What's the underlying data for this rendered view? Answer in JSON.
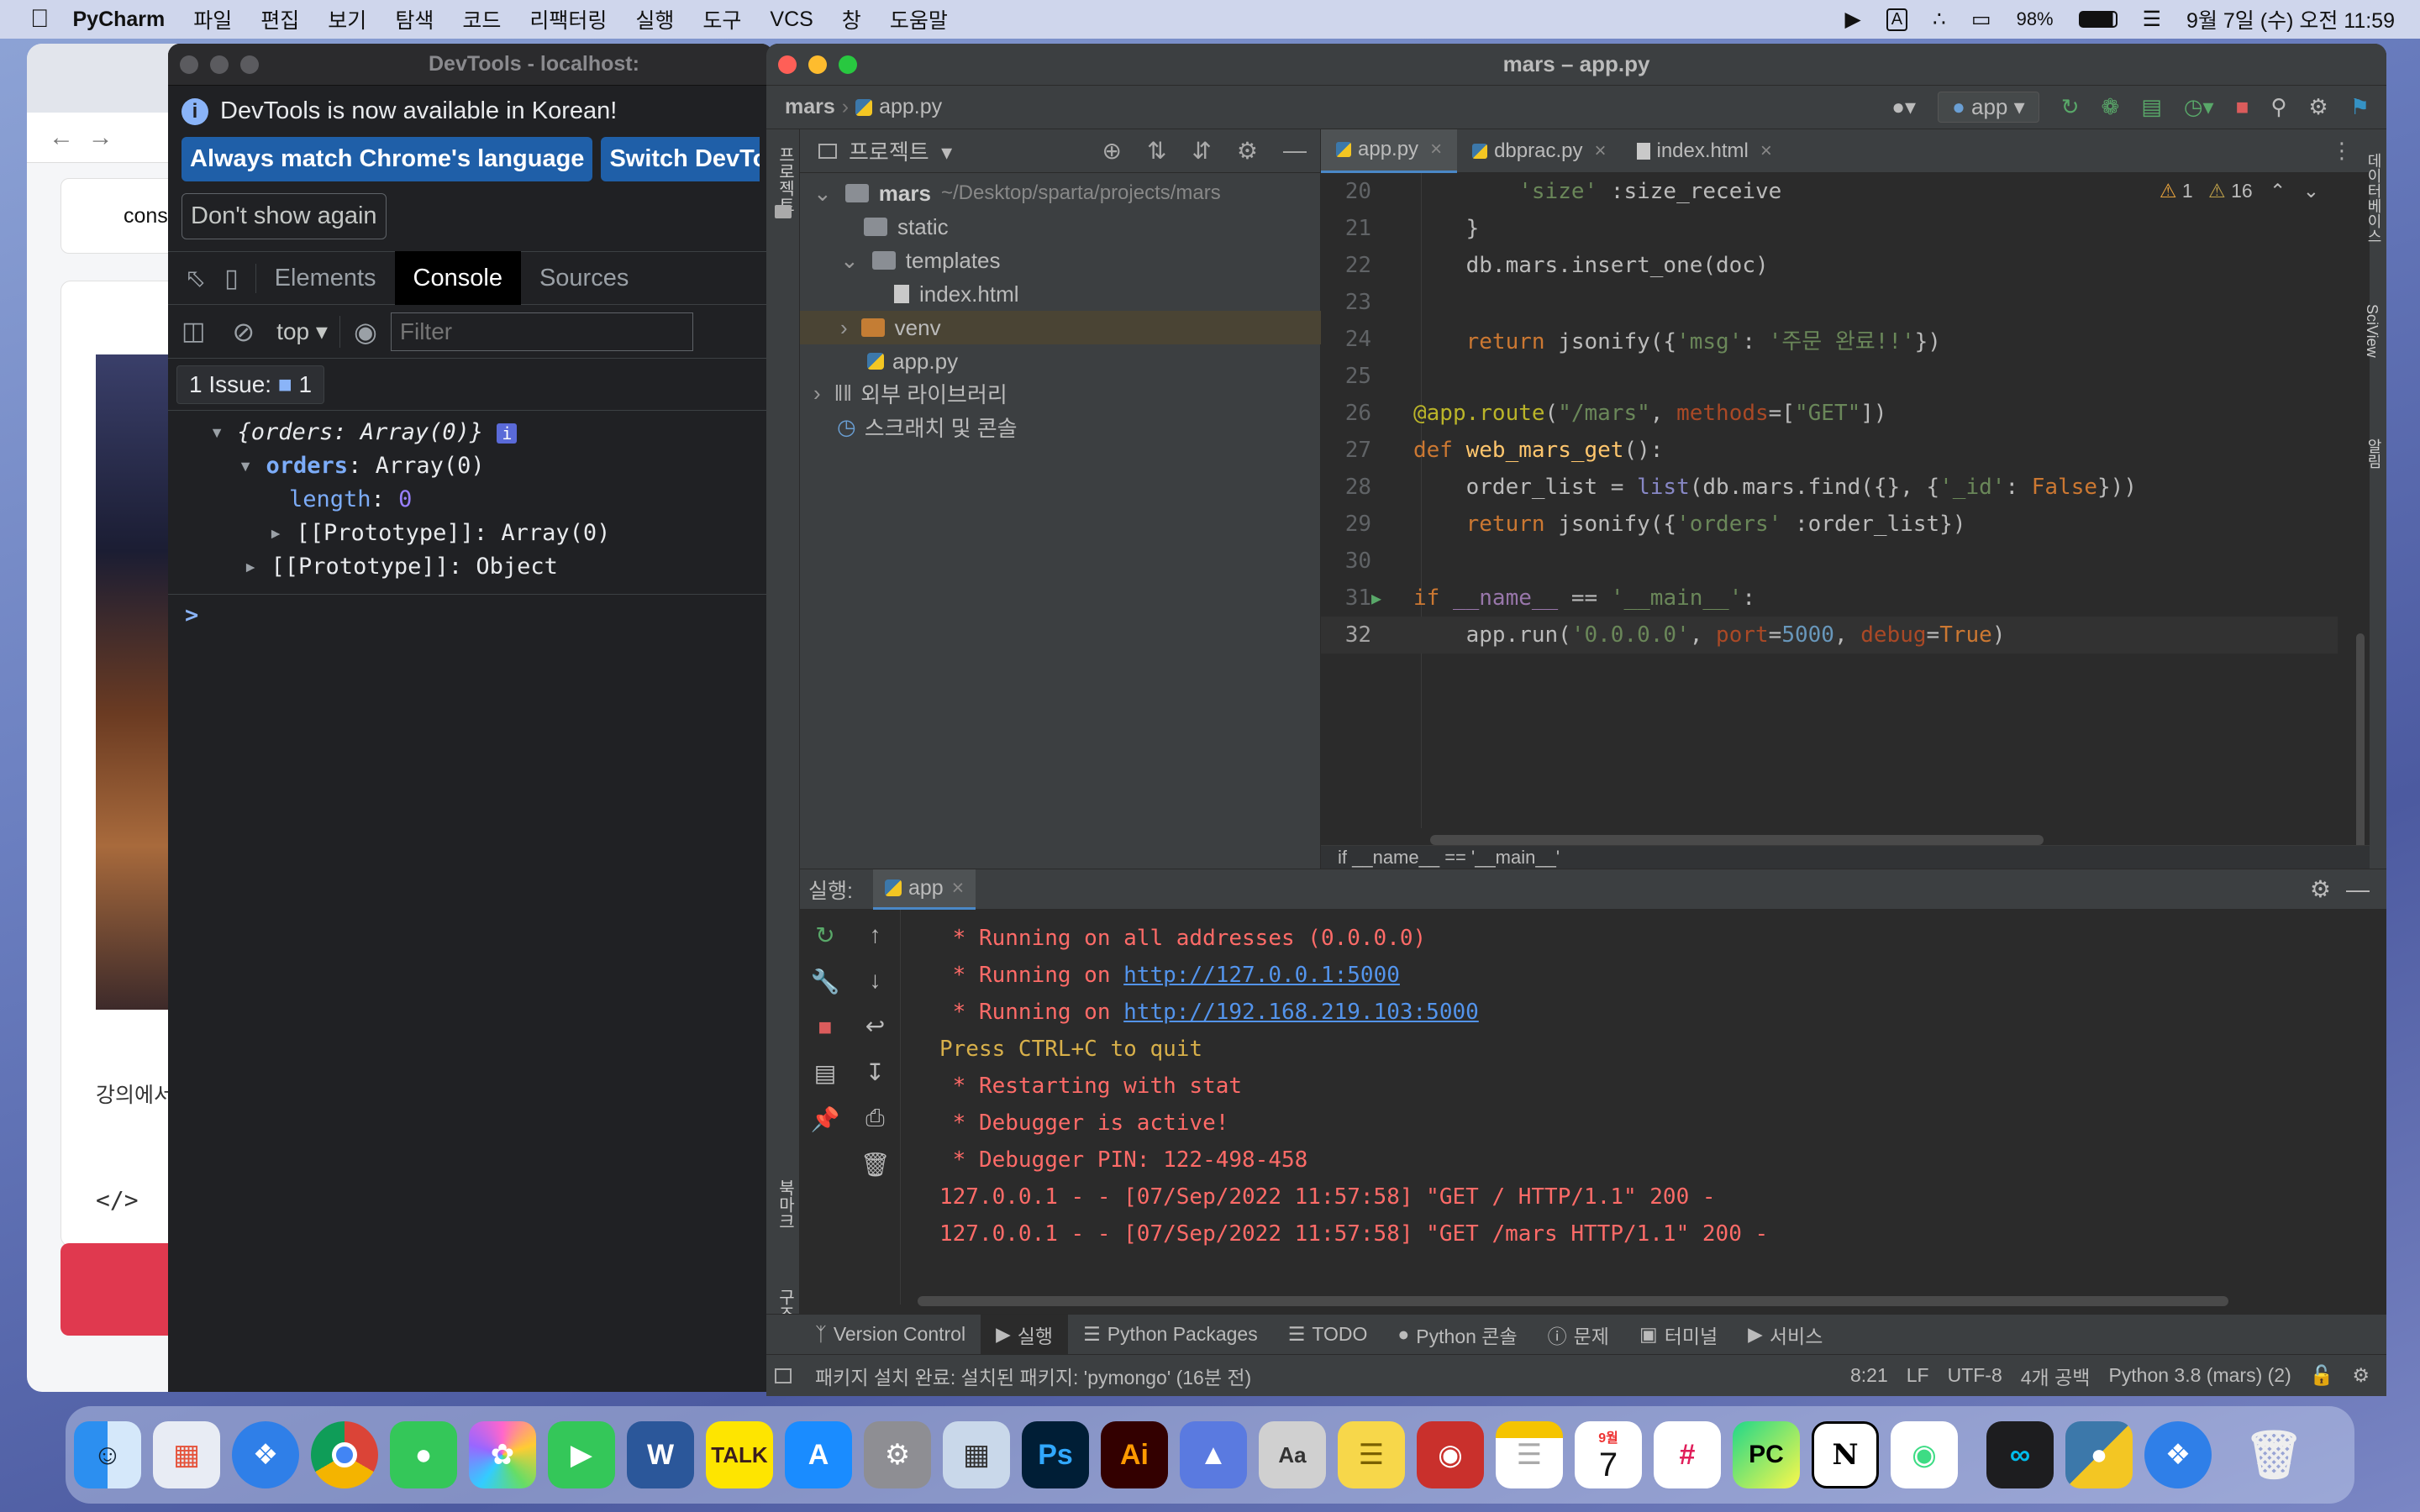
{
  "menubar": {
    "apple": "",
    "app": "PyCharm",
    "items": [
      "파일",
      "편집",
      "보기",
      "탐색",
      "코드",
      "리팩터링",
      "실행",
      "도구",
      "VCS",
      "창",
      "도움말"
    ],
    "input_source": "A",
    "battery": "98%",
    "datetime": "9월 7일 (수) 오전 11:59"
  },
  "browser": {
    "console_fragment": "consol",
    "lecture_fragment": "강의에서",
    "code_icon": "</>"
  },
  "devtools": {
    "title": "DevTools - localhost:",
    "info_text": "DevTools is now available in Korean!",
    "btn_match": "Always match Chrome's language",
    "btn_switch": "Switch DevTo",
    "btn_dont": "Don't show again",
    "tabs": [
      "Elements",
      "Console",
      "Sources"
    ],
    "context": "top",
    "filter_placeholder": "Filter",
    "issues": "1 Issue:",
    "issues_count": "1",
    "tree": {
      "root": "{orders: Array(0)}",
      "orders_key": "orders",
      "orders_val": "Array(0)",
      "length_key": "length",
      "length_val": "0",
      "proto1": "[[Prototype]]: Array(0)",
      "proto2": "[[Prototype]]: Object"
    },
    "prompt": ">"
  },
  "pycharm": {
    "title": "mars – app.py",
    "breadcrumb_project": "mars",
    "breadcrumb_file": "app.py",
    "run_config": "app",
    "project_label": "프로젝트",
    "side_labels": {
      "project": "프로젝트",
      "bookmarks": "북마크",
      "structure": "구조",
      "database": "데이터베이스",
      "sciview": "SciView",
      "notifications": "알림"
    },
    "tree": {
      "root": "mars",
      "root_path": "~/Desktop/sparta/projects/mars",
      "static": "static",
      "templates": "templates",
      "index": "index.html",
      "venv": "venv",
      "app": "app.py",
      "external": "외부 라이브러리",
      "scratch": "스크래치 및 콘솔"
    },
    "editor_tabs": [
      "app.py",
      "dbprac.py",
      "index.html"
    ],
    "inspections": {
      "warn": "1",
      "weak": "16"
    },
    "code_lines": [
      {
        "n": "20",
        "text": "        'size' :size_receive"
      },
      {
        "n": "21",
        "text": "    }"
      },
      {
        "n": "22",
        "text": "    db.mars.insert_one(doc)"
      },
      {
        "n": "23",
        "text": ""
      },
      {
        "n": "24",
        "text": "    return jsonify({'msg': '주문 완료!!'})"
      },
      {
        "n": "25",
        "text": ""
      },
      {
        "n": "26",
        "text": "@app.route(\"/mars\", methods=[\"GET\"])"
      },
      {
        "n": "27",
        "text": "def web_mars_get():"
      },
      {
        "n": "28",
        "text": "    order_list = list(db.mars.find({}, {'_id': False}))"
      },
      {
        "n": "29",
        "text": "    return jsonify({'orders' :order_list})"
      },
      {
        "n": "30",
        "text": ""
      },
      {
        "n": "31",
        "text": "if __name__ == '__main__':"
      },
      {
        "n": "32",
        "text": "    app.run('0.0.0.0', port=5000, debug=True)"
      }
    ],
    "editor_breadcrumb": "if __name__ == '__main__'",
    "run": {
      "label": "실행:",
      "tab": "app",
      "output": [
        {
          "text": " * Running on all addresses (0.0.0.0)"
        },
        {
          "prefix": " * Running on ",
          "link": "http://127.0.0.1:5000"
        },
        {
          "prefix": " * Running on ",
          "link": "http://192.168.219.103:5000"
        },
        {
          "text": "Press CTRL+C to quit"
        },
        {
          "text": " * Restarting with stat"
        },
        {
          "text": " * Debugger is active!"
        },
        {
          "text": " * Debugger PIN: 122-498-458"
        },
        {
          "text": "127.0.0.1 - - [07/Sep/2022 11:57:58] \"GET / HTTP/1.1\" 200 -"
        },
        {
          "text": "127.0.0.1 - - [07/Sep/2022 11:57:58] \"GET /mars HTTP/1.1\" 200 -"
        }
      ]
    },
    "bottom_tabs": [
      "Version Control",
      "실행",
      "Python Packages",
      "TODO",
      "Python 콘솔",
      "문제",
      "터미널",
      "서비스"
    ],
    "status": {
      "message": "패키지 설치 완료: 설치된 패키지: 'pymongo' (16분 전)",
      "pos": "8:21",
      "lf": "LF",
      "enc": "UTF-8",
      "indent": "4개 공백",
      "interp": "Python 3.8 (mars) (2)"
    }
  },
  "dock": {
    "calendar_month": "9월",
    "calendar_day": "7",
    "apps": [
      "Finder",
      "Launchpad",
      "Safari",
      "Chrome",
      "Messages",
      "Photos",
      "FaceTime",
      "Word",
      "KakaoTalk",
      "App Store",
      "System Preferences",
      "Preview",
      "Photoshop",
      "Illustrator",
      "Image Capture",
      "Dictionary",
      "Stickies",
      "Photo Booth",
      "Notes",
      "Calendar",
      "Slack",
      "PyCharm",
      "Notion",
      "Android Studio",
      "Webex",
      "Python",
      "Safari 2",
      "Trash"
    ],
    "labels": {
      "word": "W",
      "talk": "TALK",
      "ps": "Ps",
      "ai": "Ai",
      "pc": "PC",
      "notion": "N"
    }
  },
  "colors": {
    "accent_blue": "#1f5fa8",
    "pycharm_bg": "#2b2b2b",
    "devtools_bg": "#202124",
    "keyword": "#cc7832",
    "string": "#6a8759"
  }
}
